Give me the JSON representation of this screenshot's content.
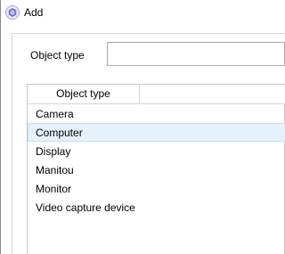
{
  "window": {
    "title": "Add",
    "icon": "hexagon-app-icon"
  },
  "form": {
    "object_type_label": "Object type",
    "object_type_value": ""
  },
  "list": {
    "column_header": "Object type",
    "items": [
      "Camera",
      "Computer",
      "Display",
      "Manitou",
      "Monitor",
      "Video capture device"
    ],
    "selected": "Computer"
  },
  "colors": {
    "selection_background": "#e5f1fb",
    "selection_border": "#c6e0f5",
    "app_icon": "#6f74c9"
  }
}
